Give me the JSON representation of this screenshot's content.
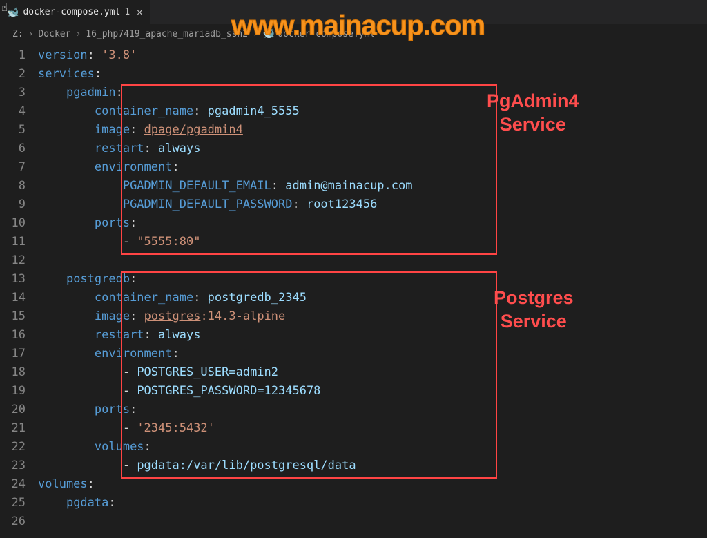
{
  "watermark": "www.mainacup.com",
  "tab": {
    "filename": "docker-compose.yml",
    "badge": "1"
  },
  "breadcrumb": {
    "part1": "Z:",
    "part2": "Docker",
    "part3": "16_php7419_apache_mariadb_ssh2",
    "file": "docker-compose.yml"
  },
  "annotations": {
    "a1": "PgAdmin4\nService",
    "a2": "Postgres\nService"
  },
  "lines": {
    "n1": "1",
    "n2": "2",
    "n3": "3",
    "n4": "4",
    "n5": "5",
    "n6": "6",
    "n7": "7",
    "n8": "8",
    "n9": "9",
    "n10": "10",
    "n11": "11",
    "n12": "12",
    "n13": "13",
    "n14": "14",
    "n15": "15",
    "n16": "16",
    "n17": "17",
    "n18": "18",
    "n19": "19",
    "n20": "20",
    "n21": "21",
    "n22": "22",
    "n23": "23",
    "n24": "24",
    "n25": "25",
    "n26": "26"
  },
  "code": {
    "version_key": "version",
    "version_val": "'3.8'",
    "services": "services",
    "pgadmin": "pgadmin",
    "container_name": "container_name",
    "cn_pgadmin": "pgadmin4_5555",
    "image": "image",
    "img_pgadmin": "dpage/pgadmin4",
    "restart": "restart",
    "always": "always",
    "environment": "environment",
    "env_email_k": "PGADMIN_DEFAULT_EMAIL",
    "env_email_v": "admin@mainacup.com",
    "env_pw_k": "PGADMIN_DEFAULT_PASSWORD",
    "env_pw_v": "root123456",
    "ports": "ports",
    "port_pgadmin": "\"5555:80\"",
    "postgredb": "postgredb",
    "cn_pg": "postgredb_2345",
    "img_pg_name": "postgres",
    "img_pg_ver": ":14.3-alpine",
    "pg_user": "POSTGRES_USER=admin2",
    "pg_pass": "POSTGRES_PASSWORD=12345678",
    "port_pg": "'2345:5432'",
    "volumes": "volumes",
    "vol_map": "pgdata:/var/lib/postgresql/data",
    "volumes_top": "volumes",
    "pgdata": "pgdata"
  }
}
